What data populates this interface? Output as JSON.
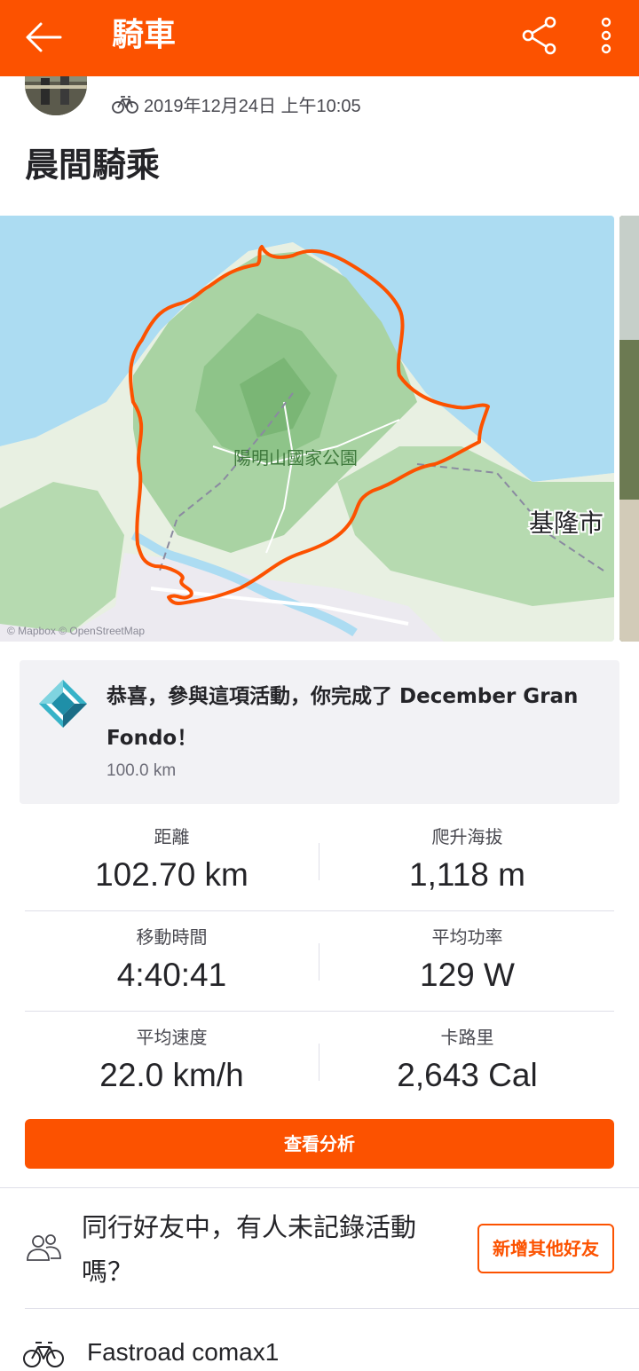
{
  "appbar": {
    "title": "騎車",
    "icons": {
      "back": "back-arrow-icon",
      "share": "share-icon",
      "more": "more-vertical-icon"
    }
  },
  "activity": {
    "date": "2019年12月24日 上午10:05",
    "title": "晨間騎乘",
    "type_icon": "bike-icon"
  },
  "map": {
    "park_label": "陽明山國家公園",
    "city_label": "基隆市",
    "attribution": "© Mapbox © OpenStreetMap",
    "route_color": "#fc5200"
  },
  "achievement": {
    "icon": "gran-fondo-badge-icon",
    "text": "恭喜，參與這項活動，你完成了 December Gran Fondo！",
    "distance": "100.0 km"
  },
  "stats": [
    {
      "left": {
        "label": "距離",
        "value": "102.70 km"
      },
      "right": {
        "label": "爬升海拔",
        "value": "1,118 m"
      }
    },
    {
      "left": {
        "label": "移動時間",
        "value": "4:40:41"
      },
      "right": {
        "label": "平均功率",
        "value": "129 W"
      }
    },
    {
      "left": {
        "label": "平均速度",
        "value": "22.0 km/h"
      },
      "right": {
        "label": "卡路里",
        "value": "2,643 Cal"
      }
    }
  ],
  "analyze_button": "查看分析",
  "friends": {
    "icon": "friends-icon",
    "prompt": "同行好友中，有人未記錄活動嗎？",
    "add_button": "新增其他好友"
  },
  "gear": {
    "icon": "bike-icon",
    "name": "Fastroad comax1"
  },
  "colors": {
    "brand": "#fc5200",
    "text": "#242428",
    "panel": "#f2f2f5"
  }
}
